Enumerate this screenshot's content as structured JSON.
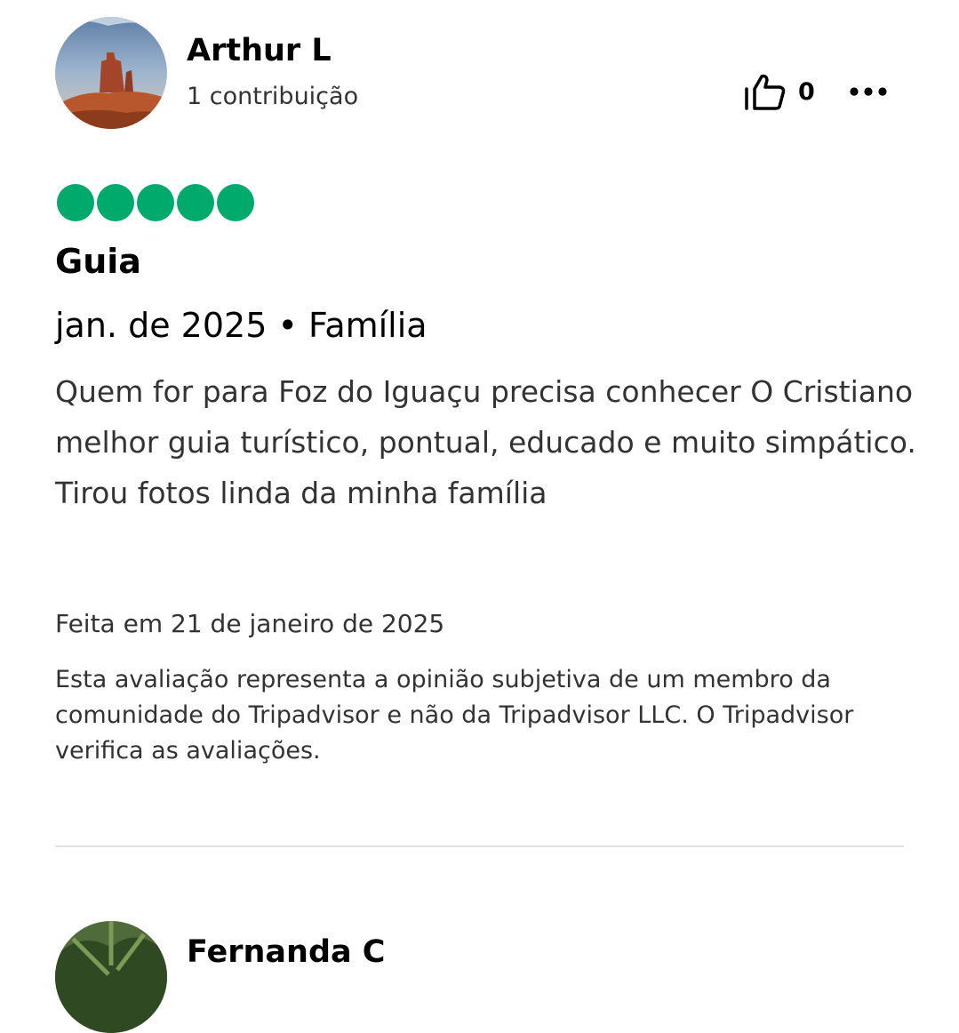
{
  "review": {
    "author": "Arthur L",
    "contributions": "1 contribuição",
    "helpful_count": "0",
    "rating": 5,
    "rating_color": "#00aa6c",
    "title": "Guia",
    "trip_meta": "jan. de 2025 • Família",
    "text": "Quem for para Foz do Iguaçu precisa conhecer O Cristiano melhor guia turístico, pontual, educado e muito simpático. Tirou fotos linda da minha família",
    "written_date": "Feita em 21 de janeiro de 2025",
    "disclaimer": "Esta avaliação representa a opinião subjetiva de um membro da comunidade do Tripadvisor e não da Tripadvisor LLC. O Tripadvisor verifica as avaliações.",
    "icons": {
      "helpful": "thumbs-up-icon",
      "more": "more-options-icon"
    }
  },
  "next_review": {
    "author": "Fernanda C"
  }
}
